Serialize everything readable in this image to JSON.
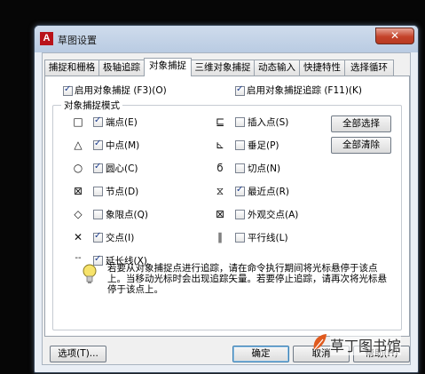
{
  "window": {
    "title": "草图设置",
    "close_glyph": "✕"
  },
  "tabs": [
    {
      "label": "捕捉和栅格",
      "active": false
    },
    {
      "label": "极轴追踪",
      "active": false
    },
    {
      "label": "对象捕捉",
      "active": true
    },
    {
      "label": "三维对象捕捉",
      "active": false
    },
    {
      "label": "动态输入",
      "active": false
    },
    {
      "label": "快捷特性",
      "active": false
    },
    {
      "label": "选择循环",
      "active": false
    }
  ],
  "options": {
    "enable_osnap": {
      "label": "启用对象捕捉 (F3)(O)",
      "checked": true
    },
    "enable_tracking": {
      "label": "启用对象捕捉追踪 (F11)(K)",
      "checked": true
    }
  },
  "group_title": "对象捕捉模式",
  "modes_left": [
    {
      "symbol": "□",
      "label": "端点(E)",
      "checked": true
    },
    {
      "symbol": "△",
      "label": "中点(M)",
      "checked": true
    },
    {
      "symbol": "○",
      "label": "圆心(C)",
      "checked": true
    },
    {
      "symbol": "⊠",
      "label": "节点(D)",
      "checked": false
    },
    {
      "symbol": "◇",
      "label": "象限点(Q)",
      "checked": false
    },
    {
      "symbol": "✕",
      "label": "交点(I)",
      "checked": true
    },
    {
      "symbol": "--",
      "label": "延长线(X)",
      "checked": true
    }
  ],
  "modes_right": [
    {
      "symbol": "⊑",
      "label": "插入点(S)",
      "checked": false
    },
    {
      "symbol": "⊾",
      "label": "垂足(P)",
      "checked": false
    },
    {
      "symbol": "ϭ",
      "label": "切点(N)",
      "checked": false
    },
    {
      "symbol": "⧖",
      "label": "最近点(R)",
      "checked": true
    },
    {
      "symbol": "⊠",
      "label": "外观交点(A)",
      "checked": false
    },
    {
      "symbol": "∥",
      "label": "平行线(L)",
      "checked": false
    }
  ],
  "buttons": {
    "select_all": "全部选择",
    "clear_all": "全部清除",
    "options": "选项(T)...",
    "ok": "确定",
    "cancel": "取消",
    "help": "帮助(H)"
  },
  "hint_text": "若要从对象捕捉点进行追踪，请在命令执行期间将光标悬停于该点上。当移动光标时会出现追踪矢量。若要停止追踪，请再次将光标悬停于该点上。",
  "watermark": "草丁图书馆",
  "colors": {
    "title_bar": "#c3d4e8",
    "close_button": "#c4432a",
    "check_mark": "#1b3b8c"
  }
}
